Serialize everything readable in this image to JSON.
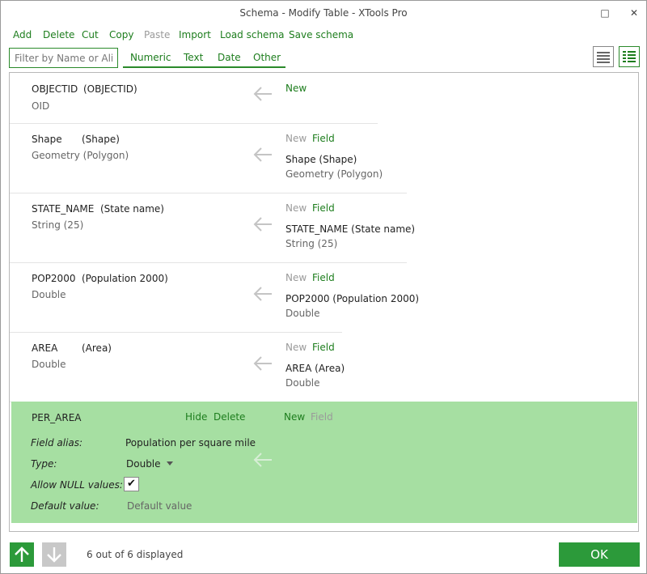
{
  "window": {
    "title": "Schema  -  Modify Table  -  XTools Pro",
    "maximize_glyph": "□",
    "close_glyph": "✕"
  },
  "toolbar": {
    "add": "Add",
    "delete": "Delete",
    "cut": "Cut",
    "copy": "Copy",
    "paste": "Paste",
    "import": "Import",
    "load_schema": "Load schema",
    "save_schema": "Save schema"
  },
  "filter": {
    "placeholder": "Filter by Name or Alias"
  },
  "tabs": [
    "Numeric",
    "Text",
    "Date",
    "Other"
  ],
  "fields": [
    {
      "name": "OBJECTID",
      "alias": "(OBJECTID)",
      "type": "OID",
      "new_label": "New",
      "field_label": "",
      "target_name": "",
      "target_type": ""
    },
    {
      "name": "Shape",
      "alias": "(Shape)",
      "type": "Geometry (Polygon)",
      "new_label": "New",
      "field_label": "Field",
      "target_name": "Shape (Shape)",
      "target_type": "Geometry (Polygon)"
    },
    {
      "name": "STATE_NAME",
      "alias": "(State name)",
      "type": "String (25)",
      "new_label": "New",
      "field_label": "Field",
      "target_name": "STATE_NAME (State name)",
      "target_type": "String (25)"
    },
    {
      "name": "POP2000",
      "alias": "(Population 2000)",
      "type": "Double",
      "new_label": "New",
      "field_label": "Field",
      "target_name": "POP2000 (Population 2000)",
      "target_type": "Double"
    },
    {
      "name": "AREA",
      "alias": "(Area)",
      "type": "Double",
      "new_label": "New",
      "field_label": "Field",
      "target_name": "AREA (Area)",
      "target_type": "Double"
    }
  ],
  "selected": {
    "name": "PER_AREA",
    "hide": "Hide",
    "delete": "Delete",
    "new_label": "New",
    "field_label": "Field",
    "alias_label": "Field alias:",
    "alias_value": "Population per square mile",
    "type_label": "Type:",
    "type_value": "Double",
    "null_label": "Allow NULL values:",
    "null_checked": true,
    "check_glyph": "✔",
    "default_label": "Default value:",
    "default_placeholder": "Default value"
  },
  "footer": {
    "count_text": "6 out of 6 displayed",
    "ok": "OK"
  },
  "colors": {
    "accent": "#1d7d1d",
    "selected_bg": "#a6dfa2",
    "ok_bg": "#2c9a3a",
    "disabled": "#9a9a9a"
  },
  "icons": {
    "maximize": "maximize-icon",
    "close": "close-icon",
    "list_view": "list-view-icon",
    "detail_view": "detail-view-icon",
    "map_arrow": "arrow-left-icon",
    "move_up": "arrow-up-icon",
    "move_down": "arrow-down-icon"
  }
}
